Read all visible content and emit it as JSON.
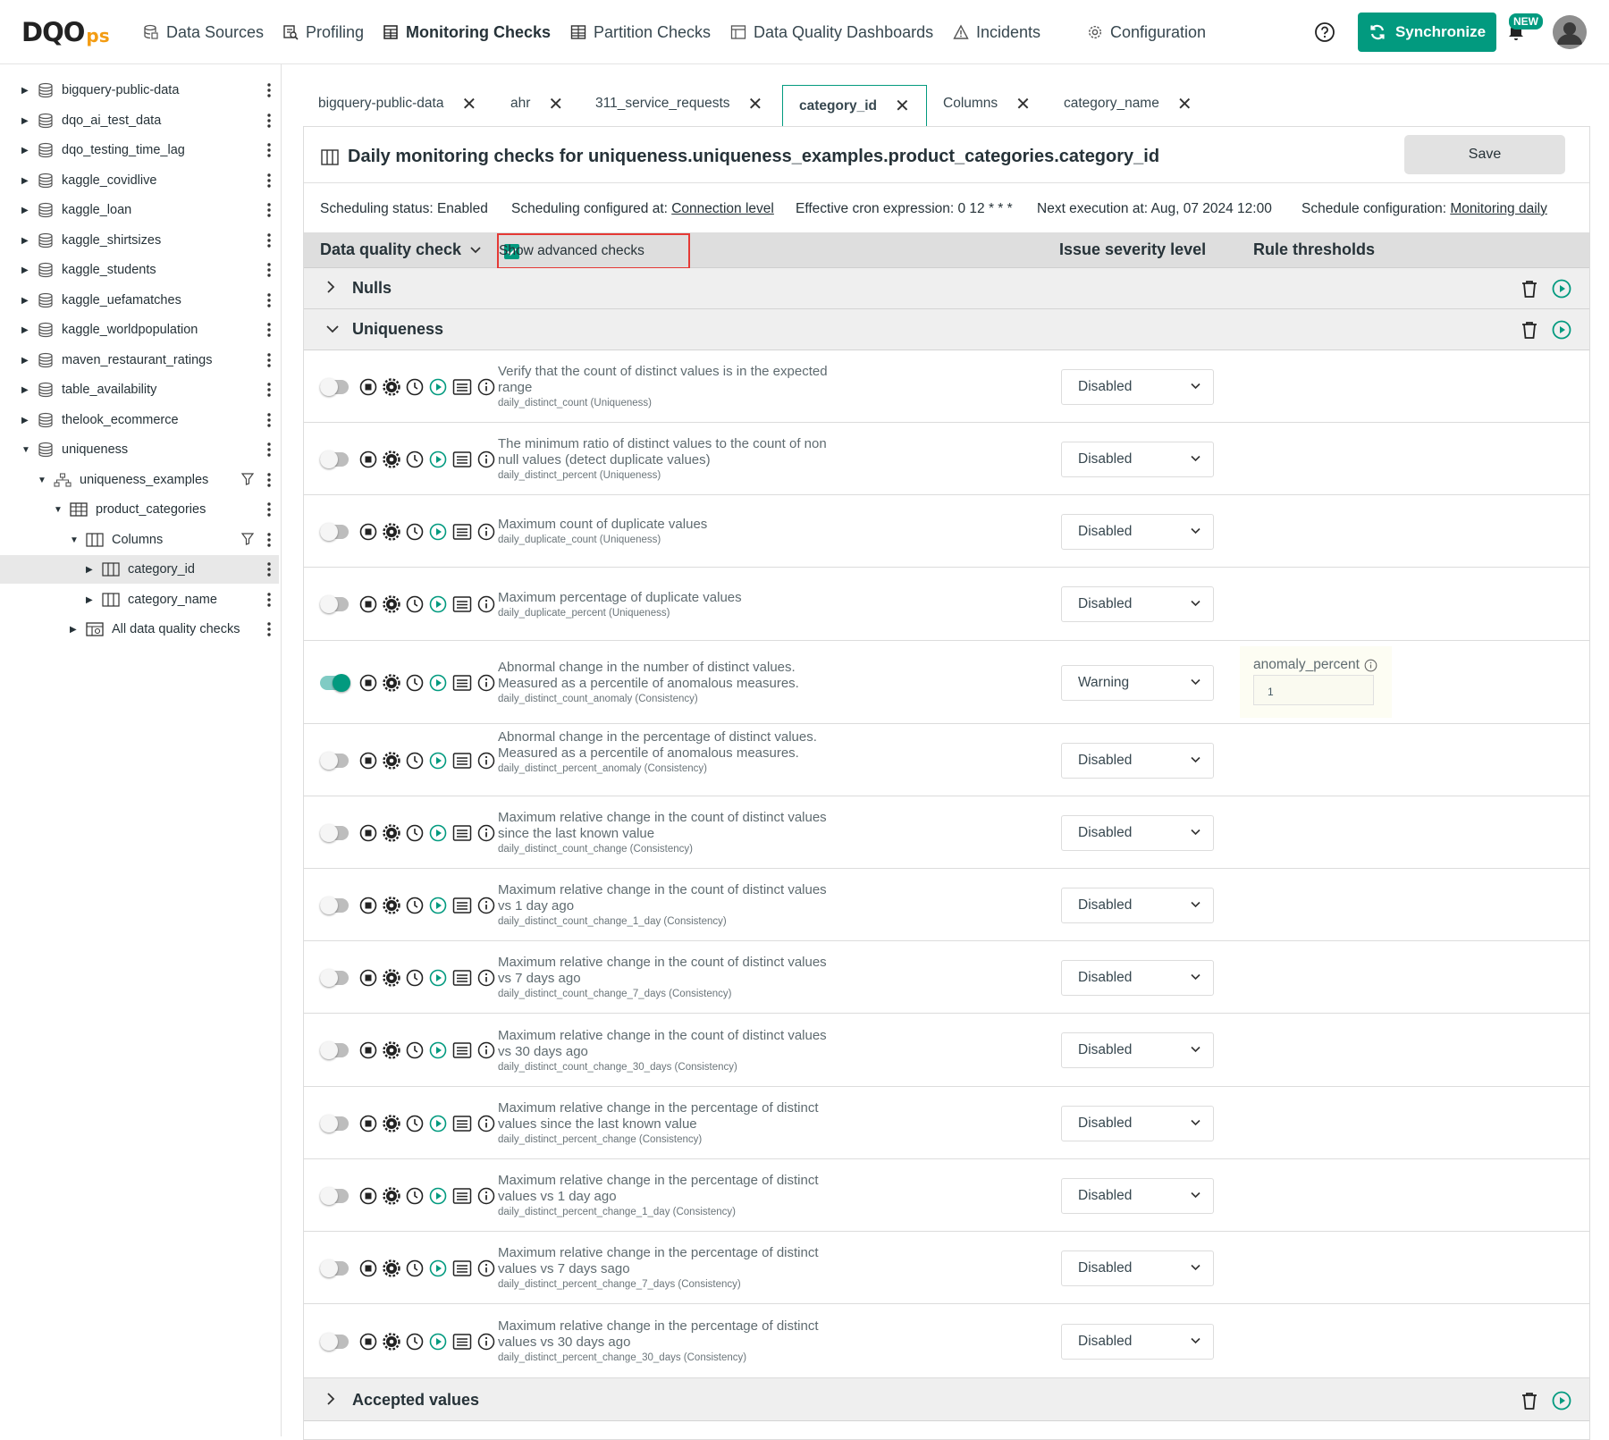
{
  "logo": {
    "main": "DQO",
    "suffix": "ps"
  },
  "nav": [
    {
      "label": "Data Sources",
      "icon": "database-icon"
    },
    {
      "label": "Profiling",
      "icon": "profiling-icon"
    },
    {
      "label": "Monitoring Checks",
      "icon": "table-icon"
    },
    {
      "label": "Partition Checks",
      "icon": "partition-icon"
    },
    {
      "label": "Data Quality Dashboards",
      "icon": "dashboard-icon"
    },
    {
      "label": "Incidents",
      "icon": "warning-icon"
    },
    {
      "label": "Configuration",
      "icon": "gear-icon"
    }
  ],
  "header": {
    "sync_label": "Synchronize",
    "new_badge": "NEW",
    "accent": "#029a7f"
  },
  "tree": [
    {
      "label": "bigquery-public-data"
    },
    {
      "label": "dqo_ai_test_data"
    },
    {
      "label": "dqo_testing_time_lag"
    },
    {
      "label": "kaggle_covidlive"
    },
    {
      "label": "kaggle_loan"
    },
    {
      "label": "kaggle_shirtsizes"
    },
    {
      "label": "kaggle_students"
    },
    {
      "label": "kaggle_uefamatches"
    },
    {
      "label": "kaggle_worldpopulation"
    },
    {
      "label": "maven_restaurant_ratings"
    },
    {
      "label": "table_availability"
    },
    {
      "label": "thelook_ecommerce"
    },
    {
      "label": "uniqueness"
    },
    {
      "label": "uniqueness_examples"
    },
    {
      "label": "product_categories"
    },
    {
      "label": "Columns"
    },
    {
      "label": "category_id"
    },
    {
      "label": "category_name"
    },
    {
      "label": "All data quality checks"
    }
  ],
  "tabs": [
    {
      "label": "bigquery-public-data"
    },
    {
      "label": "ahr"
    },
    {
      "label": "311_service_requests"
    },
    {
      "label": "category_id"
    },
    {
      "label": "Columns"
    },
    {
      "label": "category_name"
    }
  ],
  "page": {
    "title": "Daily monitoring checks for uniqueness.uniqueness_examples.product_categories.category_id",
    "save_label": "Save"
  },
  "schedule": {
    "status": "Scheduling status: Enabled",
    "configured_label": "Scheduling configured at: ",
    "configured_link": "Connection level",
    "cron": "Effective cron expression: 0 12 * * *",
    "next": "Next execution at: Aug, 07 2024 12:00",
    "config_label": "Schedule configuration: ",
    "config_link": "Monitoring daily"
  },
  "table_header": {
    "check": "Data quality check",
    "advanced": "Show advanced checks",
    "severity": "Issue severity level",
    "thresholds": "Rule thresholds"
  },
  "categories": {
    "nulls": "Nulls",
    "uniqueness": "Uniqueness",
    "accepted": "Accepted values"
  },
  "checks": [
    {
      "desc": "Verify that the count of distinct values is in the expected range",
      "name": "daily_distinct_count (Uniqueness)",
      "severity": "Disabled"
    },
    {
      "desc": "The minimum ratio of distinct values to the count of non null values (detect duplicate values)",
      "name": "daily_distinct_percent (Uniqueness)",
      "severity": "Disabled"
    },
    {
      "desc": "Maximum count of duplicate values",
      "name": "daily_duplicate_count (Uniqueness)",
      "severity": "Disabled"
    },
    {
      "desc": "Maximum percentage of duplicate values",
      "name": "daily_duplicate_percent (Uniqueness)",
      "severity": "Disabled"
    },
    {
      "desc": "Abnormal change in the number of distinct values. Measured as a percentile of anomalous measures.",
      "name": "daily_distinct_count_anomaly (Consistency)",
      "severity": "Warning",
      "threshold_label": "anomaly_percent",
      "threshold_value": "1"
    },
    {
      "desc": "Abnormal change in the percentage of distinct values. Measured as a percentile of anomalous measures.",
      "name": "daily_distinct_percent_anomaly (Consistency)",
      "severity": "Disabled"
    },
    {
      "desc": "Maximum relative change in the count of distinct values since the last known value",
      "name": "daily_distinct_count_change (Consistency)",
      "severity": "Disabled"
    },
    {
      "desc": "Maximum relative change in the count of distinct values vs 1 day ago",
      "name": "daily_distinct_count_change_1_day (Consistency)",
      "severity": "Disabled"
    },
    {
      "desc": "Maximum relative change in the count of distinct values vs 7 days ago",
      "name": "daily_distinct_count_change_7_days (Consistency)",
      "severity": "Disabled"
    },
    {
      "desc": "Maximum relative change in the count of distinct values vs 30 days ago",
      "name": "daily_distinct_count_change_30_days (Consistency)",
      "severity": "Disabled"
    },
    {
      "desc": "Maximum relative change in the percentage of distinct values since the last known value",
      "name": "daily_distinct_percent_change (Consistency)",
      "severity": "Disabled"
    },
    {
      "desc": "Maximum relative change in the percentage of distinct values vs 1 day ago",
      "name": "daily_distinct_percent_change_1_day (Consistency)",
      "severity": "Disabled"
    },
    {
      "desc": "Maximum relative change in the percentage of distinct values vs 7 days sago",
      "name": "daily_distinct_percent_change_7_days (Consistency)",
      "severity": "Disabled"
    },
    {
      "desc": "Maximum relative change in the percentage of distinct values vs 30 days ago",
      "name": "daily_distinct_percent_change_30_days (Consistency)",
      "severity": "Disabled"
    }
  ]
}
